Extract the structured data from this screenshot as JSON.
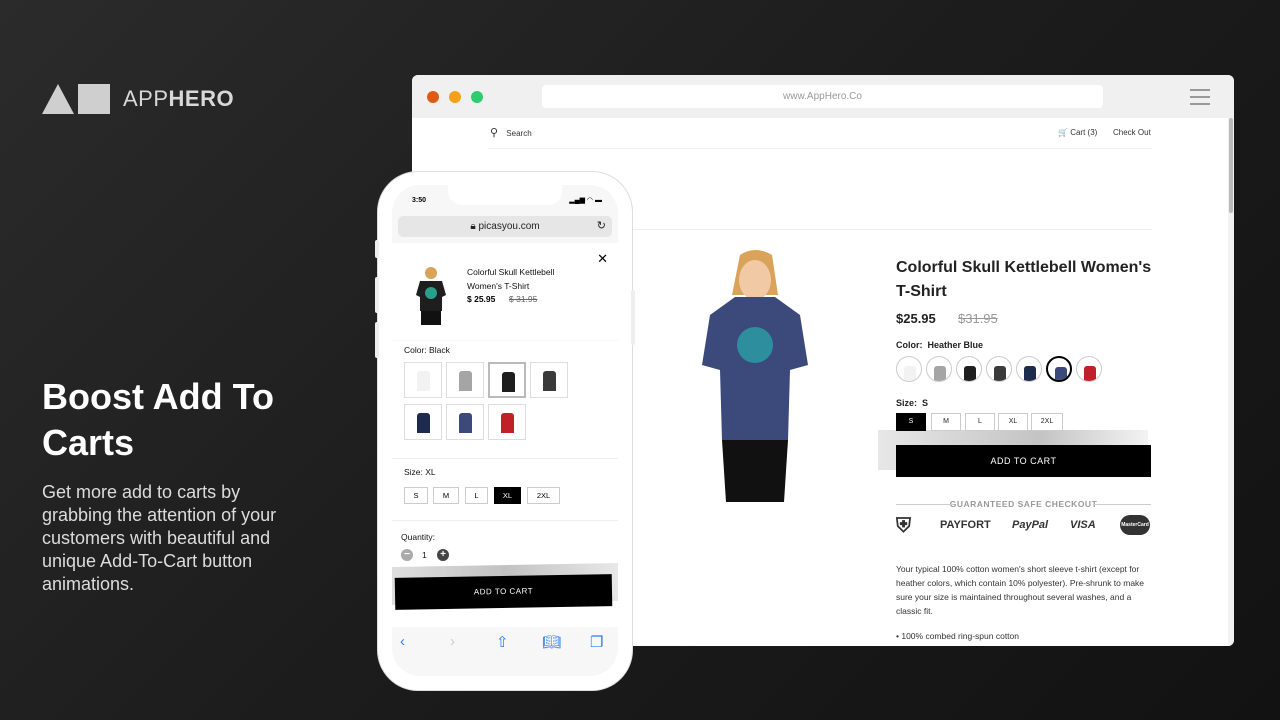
{
  "brand": {
    "logo_light": "APP",
    "logo_bold": "HERO"
  },
  "promo": {
    "headline": "Boost Add To Carts",
    "body": "Get more add to carts by grabbing the attention of your customers with beautiful and unique Add-To-Cart button animations."
  },
  "browser": {
    "url": "www.AppHero.Co",
    "window_controls": {
      "close": "#e05a16",
      "minimize": "#f4a01c",
      "maximize": "#2ecc71"
    }
  },
  "store": {
    "nav": {
      "search": "Search",
      "cart": "Cart (3)",
      "checkout": "Check Out"
    },
    "product": {
      "title": "Colorful Skull Kettlebell Women's T-Shirt",
      "price": "$25.95",
      "old_price": "$31.95",
      "color_label": "Color:",
      "color_value": "Heather Blue",
      "swatches": [
        {
          "color": "#f2f2f2"
        },
        {
          "color": "#a5a5a5"
        },
        {
          "color": "#1e1e1e"
        },
        {
          "color": "#3a3a3a"
        },
        {
          "color": "#1d2b4f"
        },
        {
          "color": "#3b4a7a",
          "selected": true
        },
        {
          "color": "#c0202a"
        }
      ],
      "size_label": "Size:",
      "size_value": "S",
      "sizes": [
        "S",
        "M",
        "L",
        "XL",
        "2XL"
      ],
      "add_to_cart": "ADD TO CART",
      "guarantee": "GUARANTEED SAFE CHECKOUT",
      "payment": [
        "PAYFORT",
        "PayPal",
        "VISA",
        "MasterCard"
      ],
      "description": "Your typical 100% cotton women's short sleeve t-shirt (except for heather colors, which contain 10% polyester). Pre-shrunk to make sure your size is maintained throughout several washes, and a classic fit.",
      "bullet": "• 100% combed ring-spun cotton"
    }
  },
  "phone": {
    "time": "3:50",
    "url": "picasyou.com",
    "popup": {
      "title": "Colorful Skull Kettlebell Women's T-Shirt",
      "price": "$ 25.95",
      "old_price": "$ 31.95"
    },
    "color_label": "Color: Black",
    "thumbs": [
      {
        "color": "#f2f2f2"
      },
      {
        "color": "#a5a5a5"
      },
      {
        "color": "#1e1e1e",
        "selected": true
      },
      {
        "color": "#3a3a3a"
      },
      {
        "color": "#1d2b4f"
      },
      {
        "color": "#3b4a7a"
      },
      {
        "color": "#c0202a"
      }
    ],
    "size_label": "Size: XL",
    "sizes": [
      "S",
      "M",
      "L",
      "XL",
      "2XL"
    ],
    "selected_size": "XL",
    "quantity_label": "Quantity:",
    "quantity": "1",
    "add_to_cart": "ADD TO CART"
  }
}
